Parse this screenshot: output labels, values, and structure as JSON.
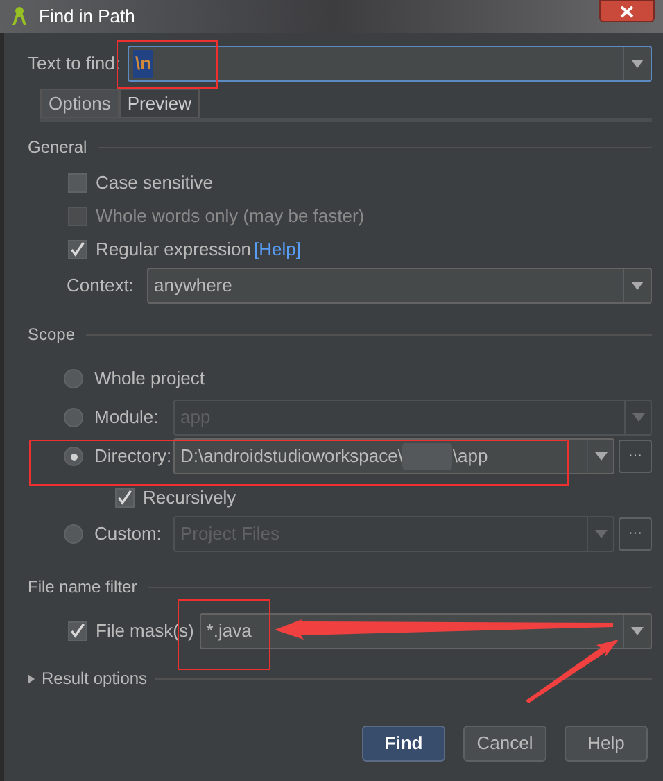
{
  "window": {
    "title": "Find in Path"
  },
  "text_to_find": {
    "label": "Text to find:",
    "value": "\\n"
  },
  "tabs": [
    {
      "label": "Options",
      "selected": true
    },
    {
      "label": "Preview",
      "selected": false
    }
  ],
  "general": {
    "title": "General",
    "options": [
      {
        "label": "Case sensitive",
        "checked": false,
        "disabled": false
      },
      {
        "label": "Whole words only (may be faster)",
        "checked": false,
        "disabled": true
      },
      {
        "label": "Regular expression",
        "link": "[Help]",
        "checked": true,
        "disabled": false
      }
    ],
    "context": {
      "label": "Context:",
      "value": "anywhere"
    }
  },
  "scope": {
    "title": "Scope",
    "options": [
      {
        "label": "Whole project",
        "selected": false
      },
      {
        "label": "Module:",
        "selected": false,
        "value": "app"
      },
      {
        "label": "Directory:",
        "selected": true,
        "value": "D:\\androidstudioworkspace\\",
        "value_end": "\\app",
        "browse": "···"
      },
      {
        "label": "Custom:",
        "selected": false,
        "value": "Project Files",
        "browse": "···"
      }
    ],
    "recursively": {
      "label": "Recursively",
      "checked": true
    }
  },
  "file_filter": {
    "title": "File name filter",
    "mask": {
      "label": "File mask(s)",
      "checked": true,
      "value": "*.java"
    }
  },
  "result_options": {
    "label": "Result options",
    "expanded": false
  },
  "buttons": [
    {
      "label": "Find",
      "kind": "primary"
    },
    {
      "label": "Cancel",
      "kind": "normal"
    },
    {
      "label": "Help",
      "kind": "normal"
    }
  ]
}
